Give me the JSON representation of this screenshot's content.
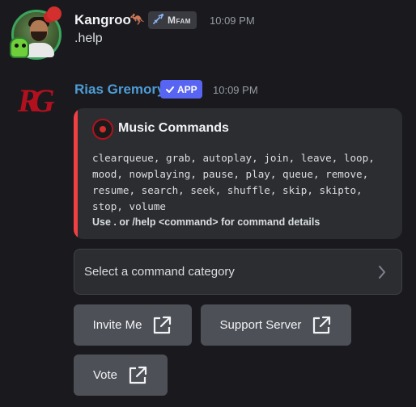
{
  "message1": {
    "username": "Kangroo",
    "emoji": "🦘",
    "tag": "Mfam",
    "time": "10:09 PM",
    "text": ".help"
  },
  "message2": {
    "username": "Rias Gremory",
    "app_badge": "APP",
    "time": "10:09 PM",
    "avatar_letters": "RG",
    "embed": {
      "accent_color": "#f23f43",
      "title": "Music Commands",
      "description": "clearqueue, grab, autoplay, join, leave, loop, mood, nowplaying, pause, play, queue, remove, resume, search, seek, shuffle, skip, skipto, stop, volume",
      "footer": "Use . or /help <command> for command details"
    },
    "select": {
      "placeholder": "Select a command category"
    },
    "buttons": {
      "invite": "Invite Me",
      "support": "Support Server",
      "vote": "Vote"
    }
  },
  "colors": {
    "background": "#1a1a1e",
    "bot_name": "#4e9cd6",
    "app_badge": "#5865f2",
    "button": "#4e5058"
  },
  "icons": [
    "check-icon",
    "sword-icon",
    "external-link-icon",
    "chevron-right-icon"
  ]
}
